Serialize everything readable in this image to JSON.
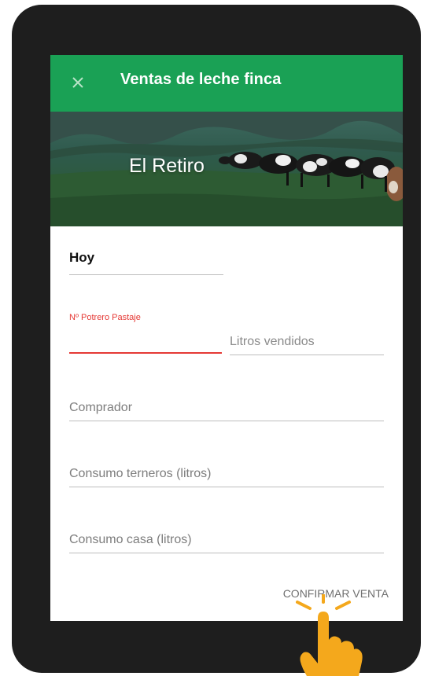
{
  "appbar": {
    "title": "Ventas de leche finca",
    "close_icon": "close-icon"
  },
  "banner": {
    "farm_name": "El Retiro"
  },
  "form": {
    "date_value": "Hoy",
    "potrero_label": "Nº Potrero Pastaje",
    "potrero_value": "",
    "litros_placeholder": "Litros vendidos",
    "comprador_placeholder": "Comprador",
    "terneros_placeholder": "Consumo terneros (litros)",
    "casa_placeholder": "Consumo casa (litros)",
    "confirm_label": "CONFIRMAR VENTA"
  },
  "colors": {
    "appbar": "#1aa155",
    "error_accent": "#e53935",
    "device_frame": "#1e1e1e",
    "hand": "#f4a81c"
  },
  "icons": {
    "tap_hint": "tap-hand-icon"
  }
}
